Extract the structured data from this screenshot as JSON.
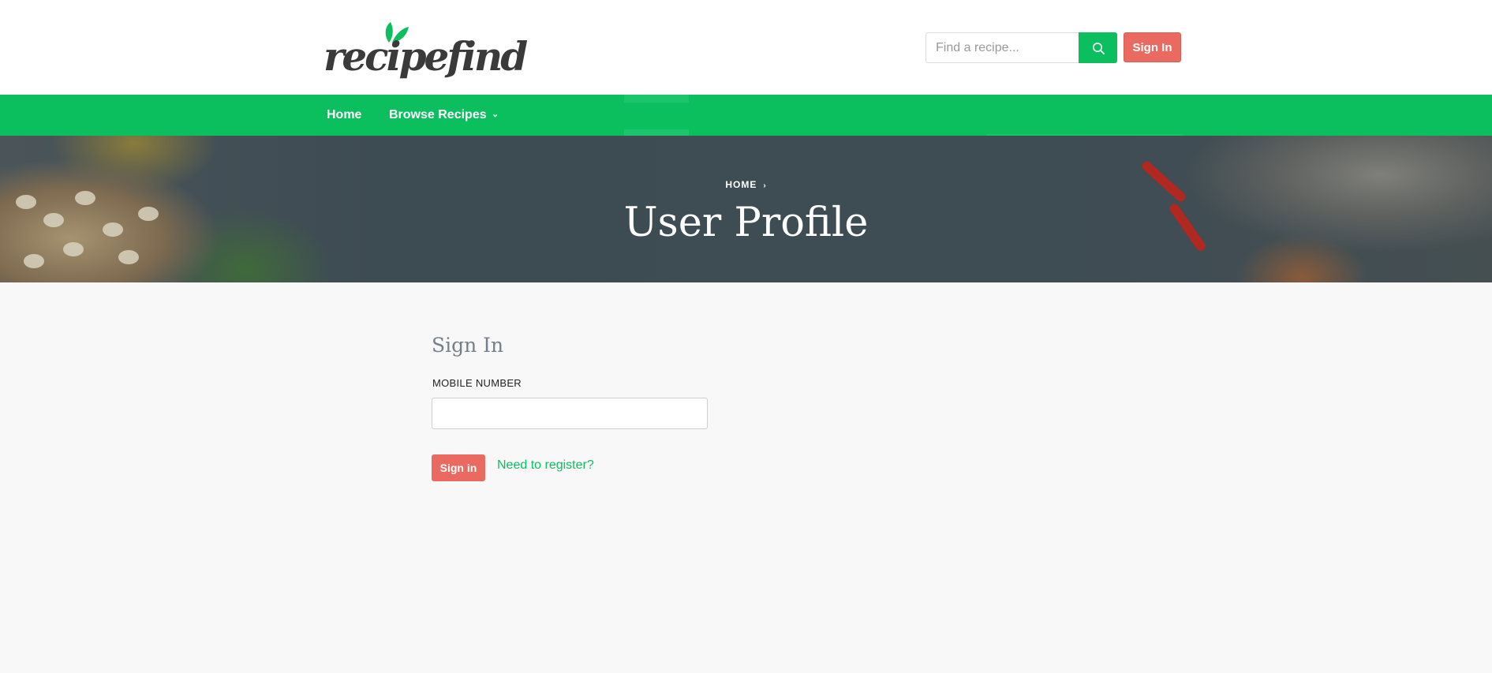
{
  "header": {
    "logo": {
      "text": "recipefind",
      "leaf_color": "#0bbe5e"
    },
    "search": {
      "placeholder": "Find a recipe...",
      "value": "",
      "icon": "search-icon"
    },
    "signin_label": "Sign In"
  },
  "nav": {
    "items": [
      {
        "label": "Home"
      },
      {
        "label": "Browse Recipes",
        "icon": "chevron-down-icon",
        "chevron": "⌄"
      }
    ]
  },
  "hero": {
    "breadcrumb": {
      "home": "HOME",
      "chevron": "›"
    },
    "title": "User Profile"
  },
  "signin_form": {
    "title": "Sign In",
    "mobile_label": "MOBILE NUMBER",
    "mobile_value": "",
    "submit_label": "Sign in",
    "register_link": "Need to register?"
  },
  "colors": {
    "brand_green": "#0bbe5e",
    "accent_red": "#ea6a61",
    "page_bg": "#f8f8f8",
    "hero_overlay": "#3c4a52"
  }
}
